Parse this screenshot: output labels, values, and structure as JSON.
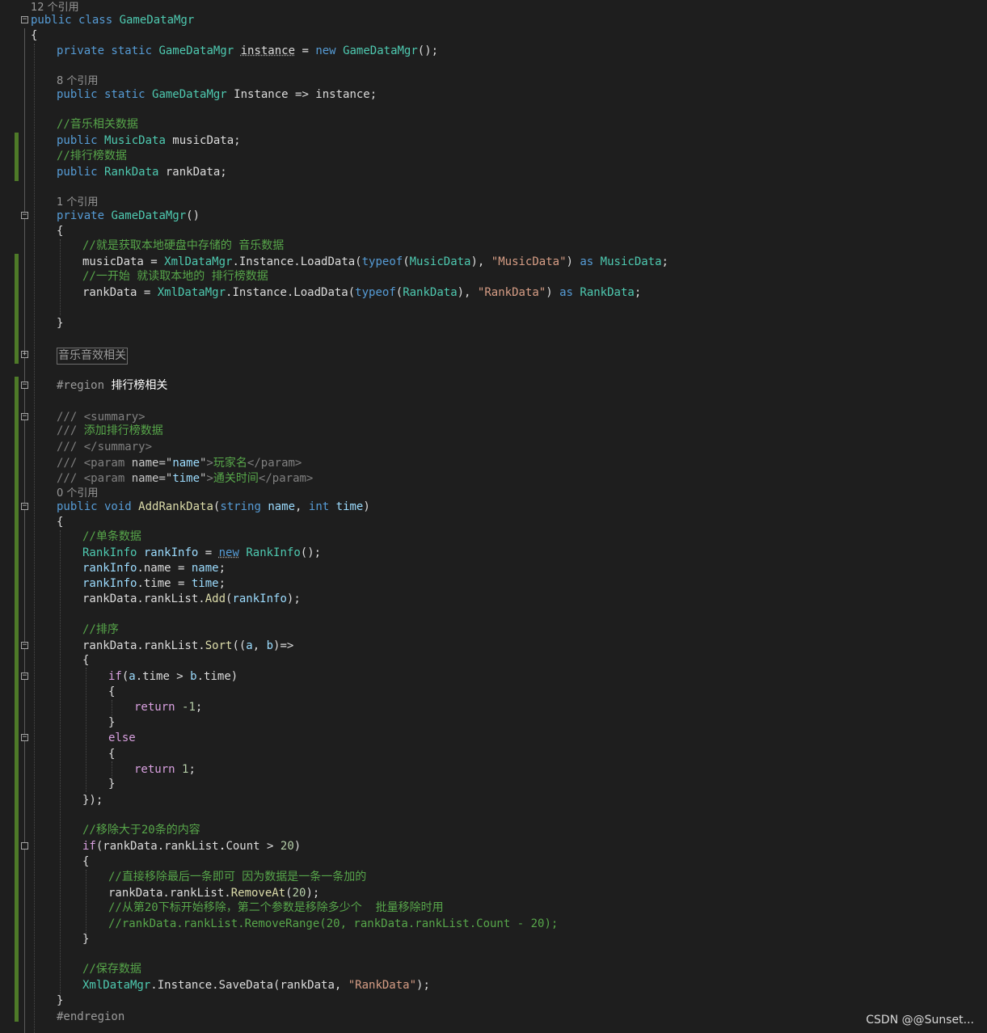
{
  "editor": {
    "codelens": {
      "class_refs": "12 个引用",
      "instance_refs": "8 个引用",
      "ctor_refs": "1 个引用",
      "add_refs": "0 个引用"
    },
    "code": {
      "class_decl_kw": "public class ",
      "class_name": "GameDataMgr",
      "open_brace": "{",
      "close_brace": "}",
      "field_private_static": "private static ",
      "field_type": "GameDataMgr",
      "field_instance_name": "instance",
      "field_assign": " = ",
      "new_kw": "new",
      "field_ctor_call": "();",
      "prop_public_static": "public static ",
      "prop_rest": " Instance => instance;",
      "comment_music": "//音乐相关数据",
      "public_kw": "public ",
      "music_type": "MusicData",
      "music_field": " musicData;",
      "comment_rank": "//排行榜数据",
      "rank_type": "RankData",
      "rank_field": " rankData;",
      "ctor_private": "private ",
      "ctor_parens": "()",
      "comment_load_music": "//就是获取本地硬盘中存储的 音乐数据",
      "music_assign": "musicData = ",
      "xml_mgr": "XmlDataMgr",
      "instance_load": ".Instance.LoadData(",
      "typeof_kw": "typeof",
      "paren_open": "(",
      "music_type_close": "), ",
      "str_music": "\"MusicData\"",
      "as_kw": "as",
      "semi": ";",
      "comment_load_rank": "//一开始 就读取本地的 排行榜数据",
      "rank_assign": "rankData = ",
      "str_rank": "\"RankData\"",
      "collapsed_region": "音乐音效相关",
      "region_kw": "#region ",
      "region_name": "排行榜相关",
      "doc_prefix": "/// ",
      "doc_summary_open": "<summary>",
      "doc_summary_text": "添加排行榜数据",
      "doc_summary_close": "</summary>",
      "doc_param_open": "<param ",
      "doc_name_attr": "name=",
      "doc_q": "\"",
      "doc_param_name": "name",
      "doc_param_time": "time",
      "doc_gt": ">",
      "doc_name_desc": "玩家名",
      "doc_time_desc": "通关时间",
      "doc_param_close": "</param>",
      "method_void": "public void ",
      "method_name": "AddRankData",
      "string_kw": "string",
      "int_kw": "int",
      "param_name": "name",
      "param_time": "time",
      "comma": ", ",
      "close_paren": ")",
      "comment_single": "//单条数据",
      "rankinfo_type": "RankInfo",
      "rankinfo_var": "rankInfo",
      "rankinfo_name_dot": ".name = ",
      "rankinfo_time_dot": ".time = ",
      "ranklist_add": "rankData.rankList.",
      "add_method": "Add",
      "comment_sort": "//排序",
      "sort_method": "Sort",
      "lambda_open": "((",
      "param_a": "a",
      "param_b": "b",
      "lambda_arrow": ")=>",
      "if_kw": "if",
      "cond_time": ".time > ",
      "time_member": ".time",
      "return_kw": "return ",
      "num_neg1": "-1",
      "num_1": "1",
      "else_kw": "else",
      "lambda_close": "});",
      "comment_remove": "//移除大于20条的内容",
      "count_member": ".Count",
      "gt_op": " > ",
      "num_20": "20",
      "comment_remove_last": "//直接移除最后一条即可 因为数据是一条一条加的",
      "remove_at": "RemoveAt",
      "comment_remove_range_hint": "//从第20下标开始移除，第二个参数是移除多少个  批量移除时用",
      "comment_remove_range": "//rankData.rankList.RemoveRange(20, rankData.rankList.Count - 20);",
      "comment_save": "//保存数据",
      "save_data": ".Instance.SaveData(rankData, ",
      "end_call": ");",
      "endregion_kw": "#endregion"
    }
  },
  "watermark": "CSDN @@Sunset..."
}
